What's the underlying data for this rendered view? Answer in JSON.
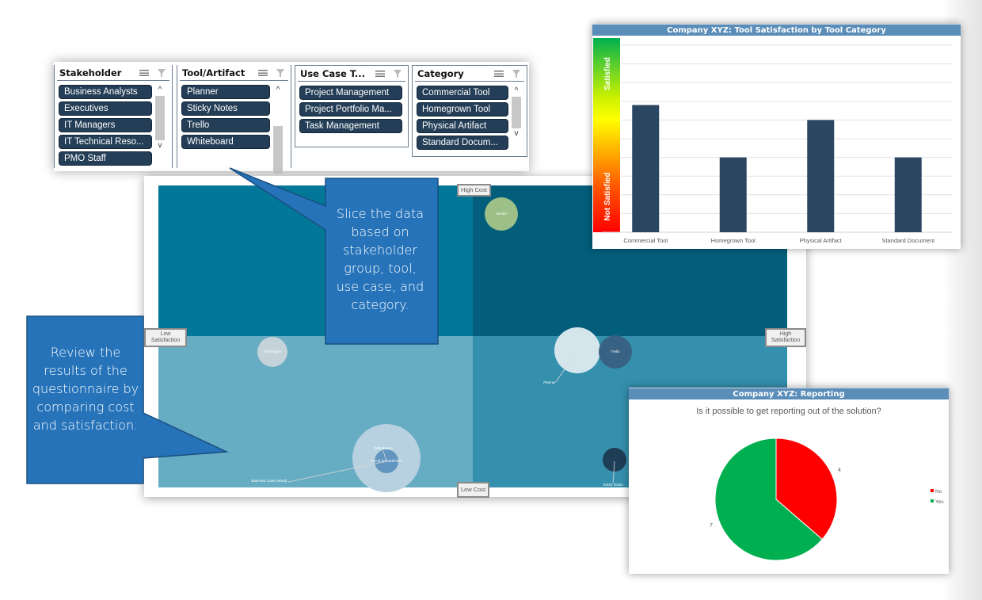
{
  "slicers": [
    {
      "title": "Stakeholder",
      "items": [
        "Business Analysts",
        "Executives",
        "IT Managers",
        "IT Technical Reso...",
        "PMO Staff"
      ],
      "has_scrollbar": true
    },
    {
      "title": "Tool/Artifact",
      "items": [
        "Planner",
        "Sticky Notes",
        "Trello",
        "Whiteboard"
      ],
      "has_scrollbar": true
    },
    {
      "title": "Use Case T...",
      "items": [
        "Project Management",
        "Project Portfolio Ma...",
        "Task Management"
      ],
      "has_scrollbar": false
    },
    {
      "title": "Category",
      "items": [
        "Commercial Tool",
        "Homegrown Tool",
        "Physical Artifact",
        "Standard Docum..."
      ],
      "has_scrollbar": true
    }
  ],
  "slicer_icons": {
    "multi_select": "multi-select-icon",
    "clear_filter": "clear-filter-icon"
  },
  "scroll_glyphs": {
    "up": "^",
    "down": "v"
  },
  "quadrant_chart": {
    "labels": {
      "top": "High Cost",
      "bottom": "Low Cost",
      "left": "Low Satisfaction",
      "right": "High Satisfaction"
    },
    "quadrant_colors": {
      "top_left": "#037797",
      "top_right": "#035e7b",
      "bottom_left": "#66acc2",
      "bottom_right": "#3590ad"
    },
    "bubbles": [
      {
        "label": "Vendor",
        "color": "#9dbf88",
        "quadrant": "top-right"
      },
      {
        "label": "MS Project",
        "color": "#c4d3da",
        "quadrant": "bottom-left"
      },
      {
        "label": "Planner",
        "color": "#d4e6ec",
        "quadrant": "bottom-right"
      },
      {
        "label": "Trello",
        "color": "#386283",
        "quadrant": "bottom-right"
      },
      {
        "label": "Whiteboard",
        "color": "#b7d1e0",
        "quadrant": "bottom-center"
      },
      {
        "label": "Excel Spreadsheet",
        "color": "#6296c0",
        "quadrant": "bottom-center"
      },
      {
        "label": "Business Case (Word)",
        "color": "#b7d1e0",
        "quadrant": "bottom-left"
      },
      {
        "label": "Sticky Notes",
        "color": "#1e3e56",
        "quadrant": "bottom-right"
      }
    ]
  },
  "callouts": {
    "slice": "Slice the data based on stakeholder group, tool, use case, and category.",
    "review": "Review the results of the questionnaire by comparing cost and satisfaction."
  },
  "chart_data": [
    {
      "type": "bar",
      "title": "Company XYZ: Tool Satisfaction by Tool Category",
      "categories": [
        "Commercial Tool",
        "Homegrown Tool",
        "Physical Artifact",
        "Standard Document"
      ],
      "values": [
        6.8,
        4,
        6,
        4
      ],
      "ylim": [
        0,
        10
      ],
      "grid": true,
      "ylabel_top": "Satisfied",
      "ylabel_bottom": "Not Satisfied",
      "bar_color": "#2a4660",
      "xlabel": "",
      "ylabel": ""
    },
    {
      "type": "pie",
      "title": "Company XYZ: Reporting",
      "subtitle": "Is it possible to get reporting out of the solution?",
      "categories": [
        "No",
        "Yes"
      ],
      "values": [
        4,
        7
      ],
      "colors": [
        "#ff0000",
        "#00b050"
      ],
      "legend": "right"
    }
  ]
}
